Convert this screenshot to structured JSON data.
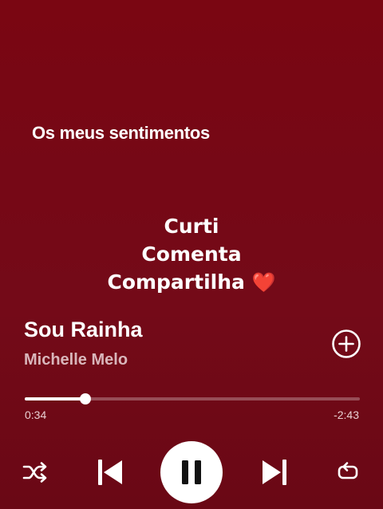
{
  "lyrics": {
    "current_line": "Os meus sentimentos"
  },
  "overlay": {
    "line1": "Curti",
    "line2": "Comenta",
    "line3": "Compartilha",
    "emoji": "❤️"
  },
  "track": {
    "title": "Sou Rainha",
    "artist": "Michelle Melo"
  },
  "progress": {
    "elapsed": "0:34",
    "remaining": "-2:43",
    "fraction": 0.18
  },
  "controls": {
    "shuffle_icon": "shuffle-icon",
    "previous_icon": "skip-previous-icon",
    "play_state_icon": "pause-icon",
    "next_icon": "skip-next-icon",
    "repeat_icon": "repeat-icon",
    "add_icon": "plus-circle-icon"
  },
  "colors": {
    "background": "#760816",
    "accent": "#ffffff",
    "secondary_text": "#d9b6bb"
  }
}
